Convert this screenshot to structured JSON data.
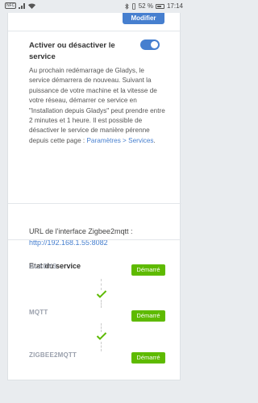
{
  "status_bar": {
    "left_badge": "NFC",
    "battery": "52 %",
    "time": "17:14"
  },
  "toolbar": {
    "modifier_label": "Modifier"
  },
  "service_toggle": {
    "title": "Activer ou désactiver le service",
    "enabled": true,
    "description": "Au prochain redémarrage de Gladys, le service démarrera de nouveau. Suivant la puissance de votre machine et la vitesse de votre réseau, démarrer ce service en \"Installation depuis Gladys\" peut prendre entre 2 minutes et 1 heure. Il est possible de désactiver le service de manière pérenne depuis cette page : ",
    "link_text": "Paramètres > Services",
    "after_link": "."
  },
  "interface": {
    "label": "URL de l'interface Zigbee2mqtt :",
    "url": "http://192.168.1.55:8082"
  },
  "status_section": {
    "title": "Etat du service",
    "services": [
      {
        "name": "GLADYS",
        "status": "Démarré"
      },
      {
        "name": "MQTT",
        "status": "Démarré"
      },
      {
        "name": "ZIGBEE2MQTT",
        "status": "Démarré"
      }
    ]
  },
  "colors": {
    "primary": "#467fcf",
    "success": "#5eba00",
    "muted": "#9aa0ac"
  }
}
